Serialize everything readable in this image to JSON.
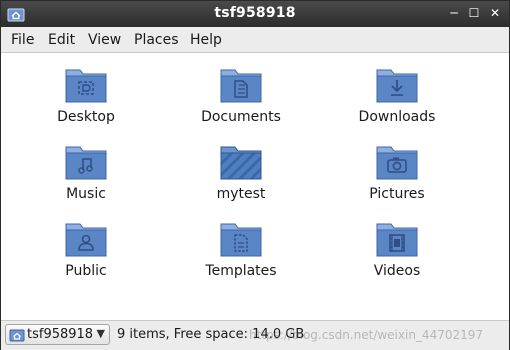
{
  "window": {
    "title": "tsf958918",
    "minimize_glyph": "─",
    "maximize_glyph": "☐",
    "close_glyph": "✕"
  },
  "menu": {
    "items": [
      "File",
      "Edit",
      "View",
      "Places",
      "Help"
    ]
  },
  "folders": [
    {
      "label": "Desktop",
      "icon": "desktop-folder-icon"
    },
    {
      "label": "Documents",
      "icon": "documents-folder-icon"
    },
    {
      "label": "Downloads",
      "icon": "downloads-folder-icon"
    },
    {
      "label": "Music",
      "icon": "music-folder-icon"
    },
    {
      "label": "mytest",
      "icon": "generic-folder-icon"
    },
    {
      "label": "Pictures",
      "icon": "pictures-folder-icon"
    },
    {
      "label": "Public",
      "icon": "public-folder-icon"
    },
    {
      "label": "Templates",
      "icon": "templates-folder-icon"
    },
    {
      "label": "Videos",
      "icon": "videos-folder-icon"
    }
  ],
  "statusbar": {
    "location": "tsf958918",
    "status": "9 items, Free space: 14.0 GB",
    "watermark": "https://blog.csdn.net/weixin_44702197"
  },
  "colors": {
    "titlebar": "#3a3a3a",
    "folder_body": "#5b86c6",
    "folder_tab": "#8eb0e0",
    "folder_emblem": "#2f4f86"
  }
}
